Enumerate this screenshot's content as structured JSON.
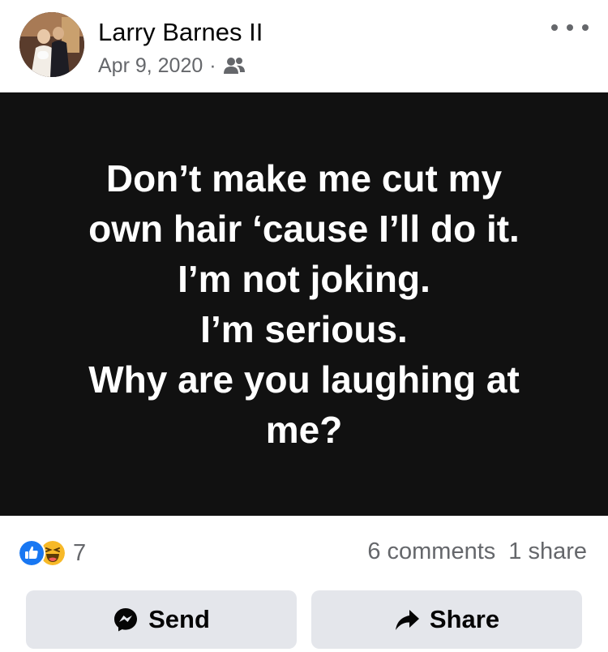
{
  "post": {
    "author": "Larry Barnes II",
    "date": "Apr 9, 2020",
    "separator": "·",
    "audience_icon": "friends-icon",
    "more_icon": "more-options-icon"
  },
  "status": {
    "background": "#111111",
    "text_color": "#ffffff",
    "lines": [
      "Don’t make me cut my",
      "own hair ‘cause I’ll do it.",
      "I’m not joking.",
      "I’m serious.",
      "Why are you laughing at",
      "me?"
    ]
  },
  "stats": {
    "reaction_icons": [
      "like-icon",
      "haha-icon"
    ],
    "reaction_count": "7",
    "comments": "6 comments",
    "shares": "1 share"
  },
  "actions": {
    "send_label": "Send",
    "send_icon": "messenger-icon",
    "share_label": "Share",
    "share_icon": "share-arrow-icon"
  },
  "colors": {
    "like_blue": "#1877f2",
    "haha_yellow": "#f7b928",
    "secondary_text": "#65676b",
    "button_bg": "#e4e6eb"
  }
}
